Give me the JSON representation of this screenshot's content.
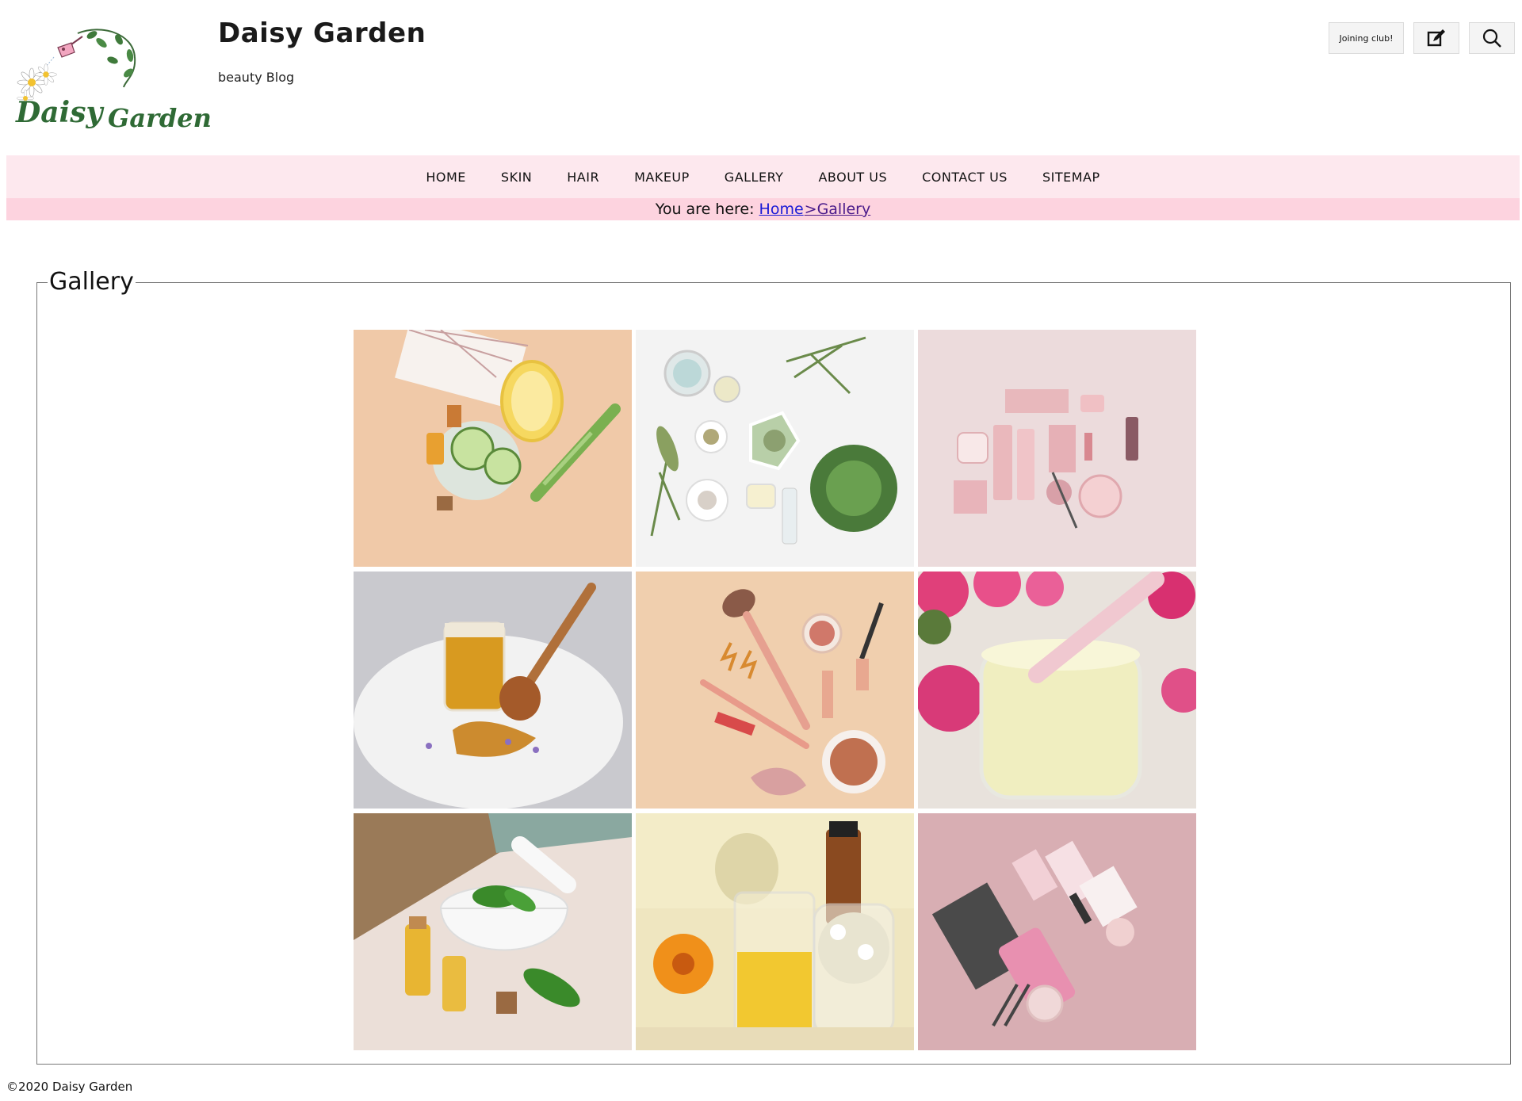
{
  "header": {
    "site_title": "Daisy Garden",
    "tagline": "beauty Blog",
    "logo_text": "Daisy Garden",
    "join_label": "Joining club!",
    "edit_icon": "edit-icon",
    "search_icon": "search-icon"
  },
  "nav": {
    "items": [
      "HOME",
      "SKIN",
      "HAIR",
      "MAKEUP",
      "GALLERY",
      "ABOUT US",
      "CONTACT US",
      "SITEMAP"
    ]
  },
  "breadcrumb": {
    "prefix": "You are here:",
    "home": "Home",
    "separator": ">",
    "current": "Gallery"
  },
  "gallery": {
    "legend": "Gallery",
    "images": [
      {
        "name": "skincare-ingredients-cucumber-lemon",
        "bg": "#f0c9a8"
      },
      {
        "name": "herbal-ingredients-bowls",
        "bg": "#f3f3f3"
      },
      {
        "name": "pink-cosmetic-packaging",
        "bg": "#ecdbdc"
      },
      {
        "name": "honey-jar-salt",
        "bg": "#c9c9ce"
      },
      {
        "name": "makeup-brushes-peach",
        "bg": "#f0cfae"
      },
      {
        "name": "cream-jar-roses",
        "bg": "#e8e2dc"
      },
      {
        "name": "mortar-basil-oils",
        "bg": "#ebdfd8"
      },
      {
        "name": "calendula-oil-beakers",
        "bg": "#efe6c0"
      },
      {
        "name": "pink-makeup-flatlay",
        "bg": "#d8aeb3"
      }
    ]
  },
  "footer": {
    "copyright": "©2020 Daisy Garden"
  },
  "colors": {
    "nav_bg": "#fde8ee",
    "breadcrumb_bg": "#fdd3df",
    "link": "#1a1ad6"
  }
}
